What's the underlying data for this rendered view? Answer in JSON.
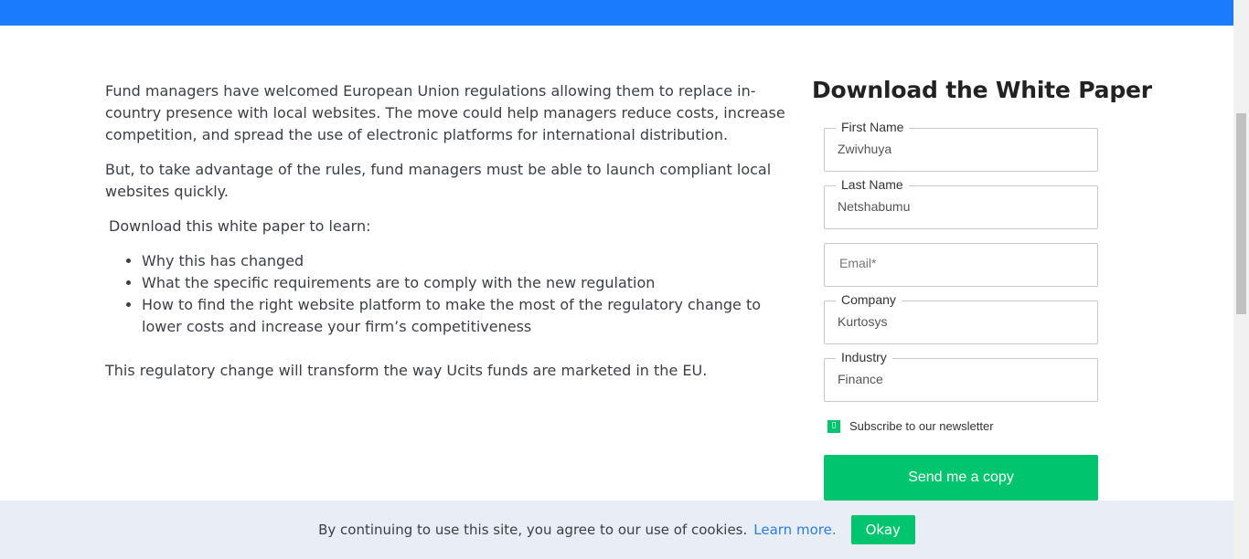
{
  "colors": {
    "topbar": "#1a7cfd",
    "accent_green": "#00c46e",
    "link_blue": "#2a7ee8",
    "cookie_bg": "#e9edf5"
  },
  "article": {
    "paragraph_1": "Fund managers have welcomed European Union regulations allowing them to replace in-country presence with local websites. The move could help managers reduce costs, increase competition, and spread the use of electronic platforms for international distribution.",
    "paragraph_2": "But, to take advantage of the rules, fund managers must be able to launch compliant local websites quickly.",
    "intro": "Download this white paper to learn:",
    "bullets": [
      "Why this has changed",
      "What the specific requirements are to comply with the new regulation",
      "How to find the right website platform to make the most of the regulatory change to lower costs and increase your firm’s competitiveness"
    ],
    "closing": "This regulatory change will transform the way Ucits funds are marketed in the EU."
  },
  "form": {
    "title": "Download the White Paper",
    "fields": [
      {
        "label": "First Name",
        "value": "Zwivhuya",
        "placeholder": ""
      },
      {
        "label": "Last Name",
        "value": "Netshabumu",
        "placeholder": ""
      },
      {
        "label": "",
        "value": "",
        "placeholder": "Email*"
      },
      {
        "label": "Company",
        "value": "Kurtosys",
        "placeholder": ""
      },
      {
        "label": "Industry",
        "value": "Finance",
        "placeholder": ""
      }
    ],
    "checkbox_icon": "checkbox-checked-icon",
    "checkbox_glyph": "▯",
    "subscribe_label": "Subscribe to our newsletter",
    "submit_label": "Send me a copy"
  },
  "cookie_bar": {
    "text": "By continuing to use this site, you agree to our use of cookies.",
    "link": "Learn more.",
    "button": "Okay"
  }
}
